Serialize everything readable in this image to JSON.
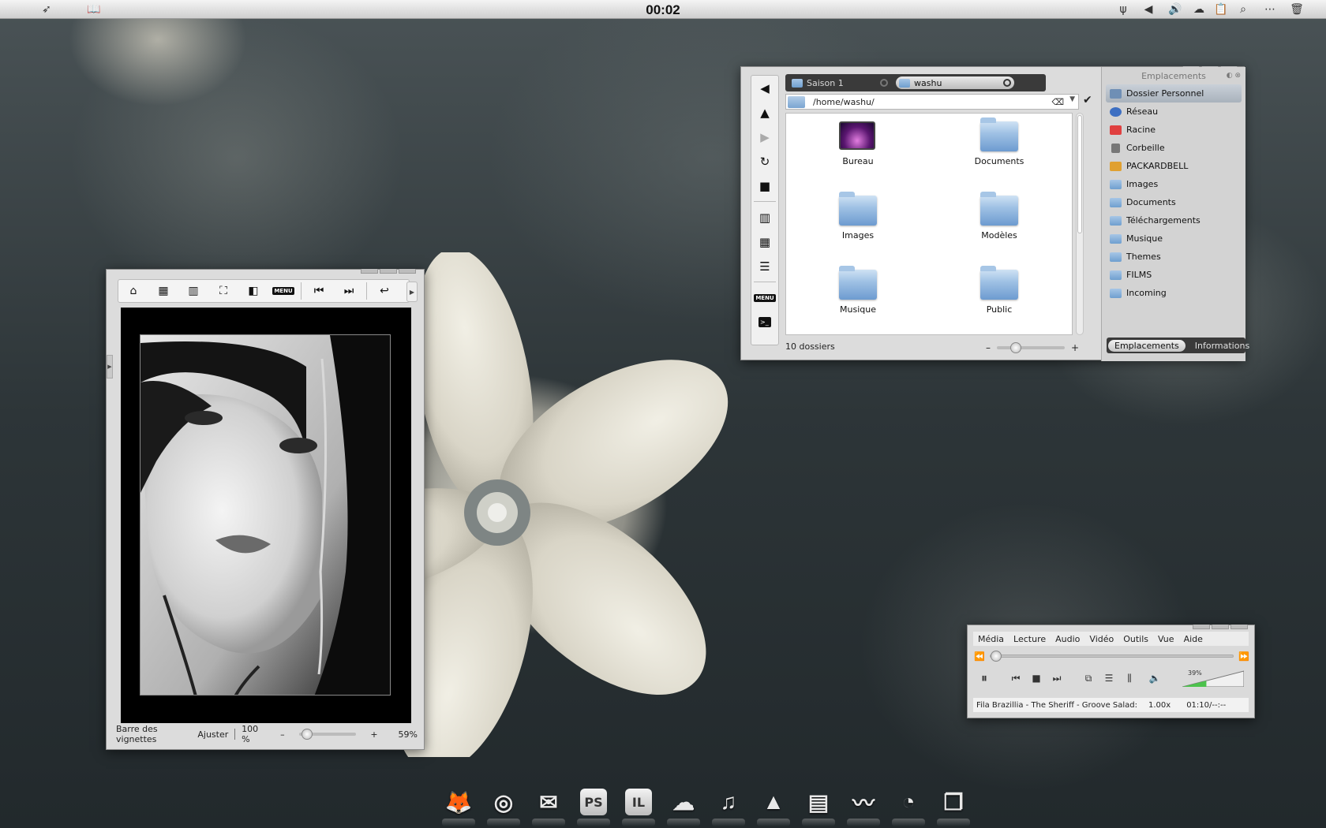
{
  "top_panel": {
    "clock": "00:02",
    "left_icons": [
      "feather-icon",
      "book-icon"
    ],
    "right_icons": [
      "usb-icon",
      "arrow-left-icon",
      "volume-icon",
      "cloud-icon",
      "clipboard-icon",
      "search-icon",
      "chat-icon",
      "trash-icon"
    ]
  },
  "file_manager": {
    "tabs": [
      {
        "label": "Saison 1"
      },
      {
        "label": "washu"
      }
    ],
    "path": "/home/washu/",
    "items": [
      {
        "label": "Bureau",
        "icon": "desktop-folder-icon"
      },
      {
        "label": "Documents",
        "icon": "folder-icon"
      },
      {
        "label": "Images",
        "icon": "folder-icon"
      },
      {
        "label": "Modèles",
        "icon": "folder-icon"
      },
      {
        "label": "Musique",
        "icon": "folder-icon"
      },
      {
        "label": "Public",
        "icon": "folder-icon"
      }
    ],
    "status": "10 dossiers",
    "zoom_fraction": 0.23,
    "sidebar": {
      "title": "Emplacements",
      "places": [
        {
          "label": "Dossier Personnel",
          "color": "#6f8fb5"
        },
        {
          "label": "Réseau",
          "color": "#3d6fc2"
        },
        {
          "label": "Racine",
          "color": "#e04040"
        },
        {
          "label": "Corbeille",
          "color": "#777777"
        },
        {
          "label": "PACKARDBELL",
          "color": "#e0a030"
        }
      ],
      "bookmarks": [
        {
          "label": "Images"
        },
        {
          "label": "Documents"
        },
        {
          "label": "Téléchargements"
        },
        {
          "label": "Musique"
        },
        {
          "label": "Themes"
        },
        {
          "label": "FILMS"
        },
        {
          "label": "Incoming"
        }
      ],
      "tabs": [
        "Emplacements",
        "Informations"
      ]
    }
  },
  "image_viewer": {
    "toolbar_icons": [
      "home-icon",
      "grid-icon",
      "filmstrip-icon",
      "fullscreen-icon",
      "sidebar-icon",
      "menu-icon",
      "previous-icon",
      "next-icon",
      "back-icon"
    ],
    "menu_label": "MENU",
    "status": {
      "thumbnails": "Barre des vignettes",
      "fit": "Ajuster",
      "zoom": "100 %",
      "minus": "–",
      "plus": "+",
      "percent": "59%"
    },
    "slider_fraction": 0.05
  },
  "media_player": {
    "menu": [
      "Média",
      "Lecture",
      "Audio",
      "Vidéo",
      "Outils",
      "Vue",
      "Aide"
    ],
    "volume": "39%",
    "volume_fraction": 0.39,
    "now_playing": "Fila Brazillia - The Sheriff - Groove Salad: a n",
    "speed": "1.00x",
    "time": "01:10/--:--"
  },
  "dock": [
    {
      "name": "firefox-icon",
      "glyph": "🦊"
    },
    {
      "name": "rss-icon",
      "glyph": "◎"
    },
    {
      "name": "mail-icon",
      "glyph": "✉"
    },
    {
      "name": "photoshop-icon",
      "glyph": "PS"
    },
    {
      "name": "illustrator-icon",
      "glyph": "IL"
    },
    {
      "name": "messenger-icon",
      "glyph": "☁"
    },
    {
      "name": "music-icon",
      "glyph": "♫"
    },
    {
      "name": "vlc-icon",
      "glyph": "▲"
    },
    {
      "name": "notes-icon",
      "glyph": "▤"
    },
    {
      "name": "birds-icon",
      "glyph": "〰"
    },
    {
      "name": "satellite-icon",
      "glyph": "◔"
    },
    {
      "name": "files-icon",
      "glyph": "❐"
    }
  ]
}
